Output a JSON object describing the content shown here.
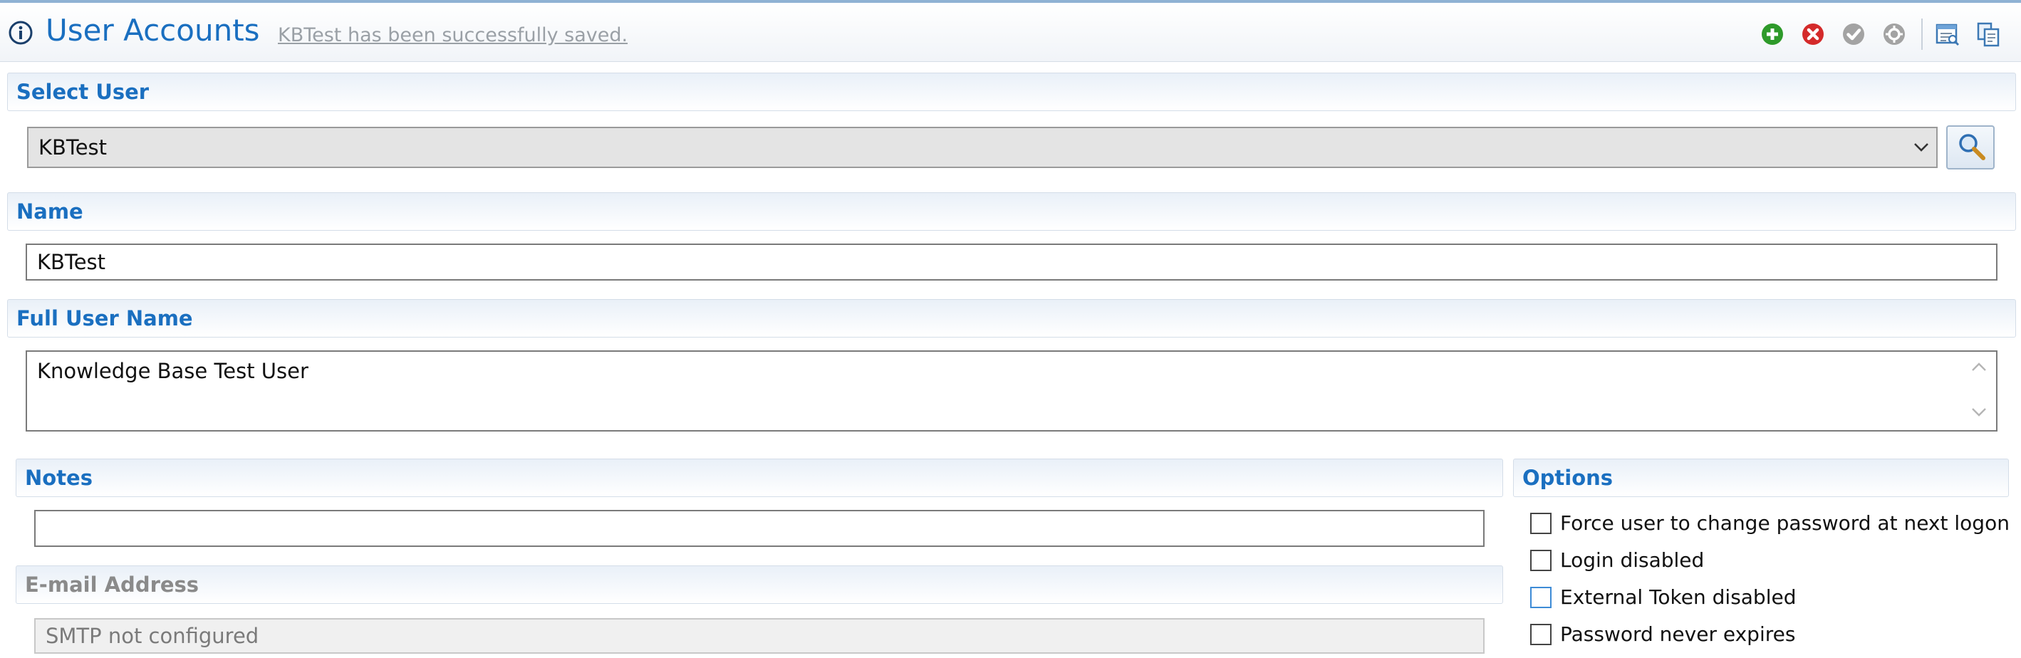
{
  "header": {
    "title": "User Accounts",
    "status_message": "KBTest has been successfully saved.",
    "toolbar": [
      {
        "name": "add-icon",
        "color": "#2e9a2a"
      },
      {
        "name": "delete-icon",
        "color": "#d42a2a"
      },
      {
        "name": "confirm-icon",
        "color": "#9a9a9a"
      },
      {
        "name": "settings-icon",
        "color": "#9a9a9a"
      },
      {
        "name": "report-icon",
        "color": "#3c78b4"
      },
      {
        "name": "copy-icon",
        "color": "#3c78b4"
      }
    ]
  },
  "select_user": {
    "label": "Select User",
    "value": "KBTest"
  },
  "name": {
    "label": "Name",
    "value": "KBTest"
  },
  "full_user_name": {
    "label": "Full User Name",
    "value": "Knowledge Base Test User"
  },
  "notes": {
    "label": "Notes",
    "value": ""
  },
  "email": {
    "label": "E-mail Address",
    "value": "SMTP not configured"
  },
  "options": {
    "label": "Options",
    "items": [
      {
        "label": "Force user to change password at next logon",
        "checked": false
      },
      {
        "label": "Login disabled",
        "checked": false
      },
      {
        "label": "External Token disabled",
        "checked": false
      },
      {
        "label": "Password never expires",
        "checked": false
      }
    ]
  },
  "colors": {
    "accent": "#1a6fc0",
    "section_border": "#d4dde8"
  }
}
